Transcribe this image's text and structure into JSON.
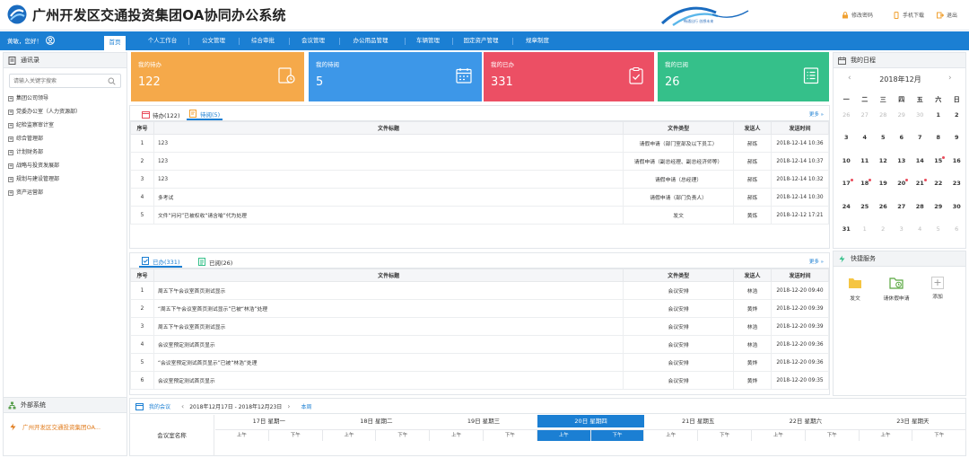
{
  "app": {
    "title": "广州开发区交通投资集团OA协同办公系统",
    "wave_text": "畅通出行 创想未来"
  },
  "header_links": [
    {
      "label": "修改密码",
      "icon": "lock-icon"
    },
    {
      "label": "手机下载",
      "icon": "phone-icon"
    },
    {
      "label": "退出",
      "icon": "exit-icon"
    }
  ],
  "nav": {
    "user": "黄敏，您好！",
    "tabs": [
      "首页",
      "个人工作台",
      "公文管理",
      "综合审批",
      "会议管理",
      "办公用品管理",
      "车辆管理",
      "固定资产管理",
      "规章制度"
    ],
    "active": "首页"
  },
  "left": {
    "title": "通讯录",
    "search_placeholder": "请输入关键字搜索",
    "items": [
      "集团公司领导",
      "党委办公室（人力资源部）",
      "纪检监察审计室",
      "综合管理部",
      "计划财务部",
      "战略与投资发展部",
      "规划与建设管理部",
      "资产运营部"
    ]
  },
  "external": {
    "title": "外部系统",
    "item": "广州开发区交通投资集团OA..."
  },
  "cards": [
    {
      "label": "我的待办",
      "value": "122",
      "color": "#f5a94a",
      "icon": "todo-icon"
    },
    {
      "label": "我的待阅",
      "value": "5",
      "color": "#3d97e8",
      "icon": "calendar-icon"
    },
    {
      "label": "我的已办",
      "value": "331",
      "color": "#ec4f64",
      "icon": "clipboard-icon"
    },
    {
      "label": "我的已阅",
      "value": "26",
      "color": "#35c08a",
      "icon": "list-icon"
    }
  ],
  "pending": {
    "tabs": [
      "待办(122)",
      "待阅(5)"
    ],
    "active": 1,
    "more": "更多",
    "columns": [
      "序号",
      "文件标题",
      "文件类型",
      "发送人",
      "发送时间"
    ],
    "rows": [
      [
        "1",
        "123",
        "请假申请（部门室部及以下员工）",
        "郝炼",
        "2018-12-14 10:36"
      ],
      [
        "2",
        "123",
        "请假申请（副总经理、副总经济师等）",
        "郝炼",
        "2018-12-14 10:37"
      ],
      [
        "3",
        "123",
        "请假申请（总经理）",
        "郝炼",
        "2018-12-14 10:32"
      ],
      [
        "4",
        "多考试",
        "请假申请（部门负责人）",
        "郝炼",
        "2018-12-14 10:30"
      ],
      [
        "5",
        "文件“问问”已被权收“请含喻”代为处理",
        "发文",
        "黄炼",
        "2018-12-12 17:21"
      ]
    ]
  },
  "done": {
    "tabs": [
      "已办(331)",
      "已阅(26)"
    ],
    "active": 0,
    "more": "更多",
    "columns": [
      "序号",
      "文件标题",
      "文件类型",
      "发送人",
      "发送时间"
    ],
    "rows": [
      [
        "1",
        "周五下午会议室首页测试显示",
        "会议安排",
        "林浩",
        "2018-12-20 09:40"
      ],
      [
        "2",
        "“周五下午会议室首页测试显示”已被“林浩”处理",
        "会议安排",
        "黄烨",
        "2018-12-20 09:39"
      ],
      [
        "3",
        "周五下午会议室首页测试显示",
        "会议安排",
        "林浩",
        "2018-12-20 09:39"
      ],
      [
        "4",
        "会议室预定测试首页显示",
        "会议安排",
        "林浩",
        "2018-12-20 09:36"
      ],
      [
        "5",
        "“会议室预定测试首页显示”已被“林浩”处理",
        "会议安排",
        "黄烨",
        "2018-12-20 09:36"
      ],
      [
        "6",
        "会议室预定测试首页显示",
        "会议安排",
        "黄烨",
        "2018-12-20 09:35"
      ]
    ]
  },
  "calendar": {
    "title": "我的日程",
    "month": "2018年12月",
    "weekdays": [
      "一",
      "二",
      "三",
      "四",
      "五",
      "六",
      "日"
    ],
    "days": [
      {
        "d": "26",
        "o": true
      },
      {
        "d": "27",
        "o": true
      },
      {
        "d": "28",
        "o": true
      },
      {
        "d": "29",
        "o": true
      },
      {
        "d": "30",
        "o": true
      },
      {
        "d": "1"
      },
      {
        "d": "2"
      },
      {
        "d": "3"
      },
      {
        "d": "4"
      },
      {
        "d": "5"
      },
      {
        "d": "6"
      },
      {
        "d": "7"
      },
      {
        "d": "8"
      },
      {
        "d": "9"
      },
      {
        "d": "10"
      },
      {
        "d": "11"
      },
      {
        "d": "12"
      },
      {
        "d": "13"
      },
      {
        "d": "14"
      },
      {
        "d": "15",
        "dot": true
      },
      {
        "d": "16"
      },
      {
        "d": "17",
        "dot": true
      },
      {
        "d": "18",
        "dot": true
      },
      {
        "d": "19"
      },
      {
        "d": "20",
        "dot": true
      },
      {
        "d": "21",
        "dot": true
      },
      {
        "d": "22"
      },
      {
        "d": "23"
      },
      {
        "d": "24"
      },
      {
        "d": "25"
      },
      {
        "d": "26"
      },
      {
        "d": "27"
      },
      {
        "d": "28"
      },
      {
        "d": "29"
      },
      {
        "d": "30"
      },
      {
        "d": "31"
      },
      {
        "d": "1",
        "o": true
      },
      {
        "d": "2",
        "o": true
      },
      {
        "d": "3",
        "o": true
      },
      {
        "d": "4",
        "o": true
      },
      {
        "d": "5",
        "o": true
      },
      {
        "d": "6",
        "o": true
      }
    ]
  },
  "quick": {
    "title": "快捷服务",
    "items": [
      {
        "label": "发文",
        "icon": "folder-icon"
      },
      {
        "label": "请休假申请",
        "icon": "folder-clock-icon"
      },
      {
        "label": "添加",
        "icon": "plus-icon"
      }
    ]
  },
  "meeting": {
    "title": "我的会议",
    "range": "2018年12月17日 - 2018年12月23日",
    "week_link": "本周",
    "room_label": "会议室名称",
    "days": [
      "17日 星期一",
      "18日 星期二",
      "19日 星期三",
      "20日 星期四",
      "21日 星期五",
      "22日 星期六",
      "23日 星期天"
    ],
    "am": "上午",
    "pm": "下午",
    "today_index": 3
  }
}
